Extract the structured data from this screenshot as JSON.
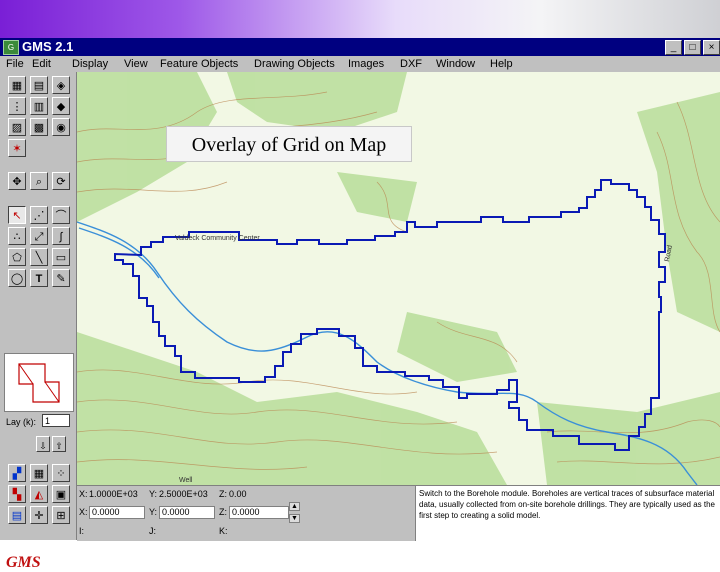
{
  "slide": {
    "overlay_label": "Overlay of Grid on Map"
  },
  "window": {
    "title": "GMS 2.1",
    "app_icon": "gms-app-icon",
    "controls": {
      "minimize": "_",
      "maximize": "□",
      "close": "×"
    }
  },
  "menu": [
    "File",
    "Edit",
    "Display",
    "View",
    "Feature Objects",
    "Drawing Objects",
    "Images",
    "DXF",
    "Window",
    "Help"
  ],
  "toolbar": {
    "icons": [
      "select-icon",
      "grid-select-icon",
      "cell-select-icon",
      "node-select-icon",
      "row-select-icon",
      "layer-select-icon",
      "column-select-icon",
      "ijk-select-icon",
      "contour-icon",
      "redo-icon",
      "pan-icon",
      "zoom-icon",
      "rotate-icon",
      "arrow-tool-icon",
      "point-tool-icon",
      "arc-tool-icon",
      "node-tool-icon",
      "vertex-tool-icon",
      "spline-tool-icon",
      "polygon-tool-icon",
      "line-tool-icon",
      "rectangle-tool-icon",
      "oval-tool-icon",
      "text-tool-icon",
      "text-edit-icon"
    ],
    "lay_label": "Lay (k):",
    "lay_value": "1",
    "logo_text": "GMS"
  },
  "status": {
    "x_label": "X:",
    "x_value": "1.0000E+03",
    "y_label": "Y:",
    "y_value": "2.5000E+03",
    "z_label": "Z:",
    "z_value": "0.00",
    "x2_label": "X:",
    "x2_value": "0.0000",
    "y2_label": "Y:",
    "y2_value": "0.0000",
    "z2_label": "Z:",
    "z2_value": "0.0000",
    "i_label": "I:",
    "j_label": "J:",
    "k_label": "K:",
    "help_text": "Switch to the Borehole module. Boreholes are vertical traces of subsurface material data, usually collected from on-site borehole drillings. They are typically used as the first step to creating a solid model."
  },
  "colors": {
    "grid_boundary": "#0a1ab4",
    "river": "#3a8fd8",
    "map_background": "#f2f8e4",
    "title_bar": "#000080"
  }
}
